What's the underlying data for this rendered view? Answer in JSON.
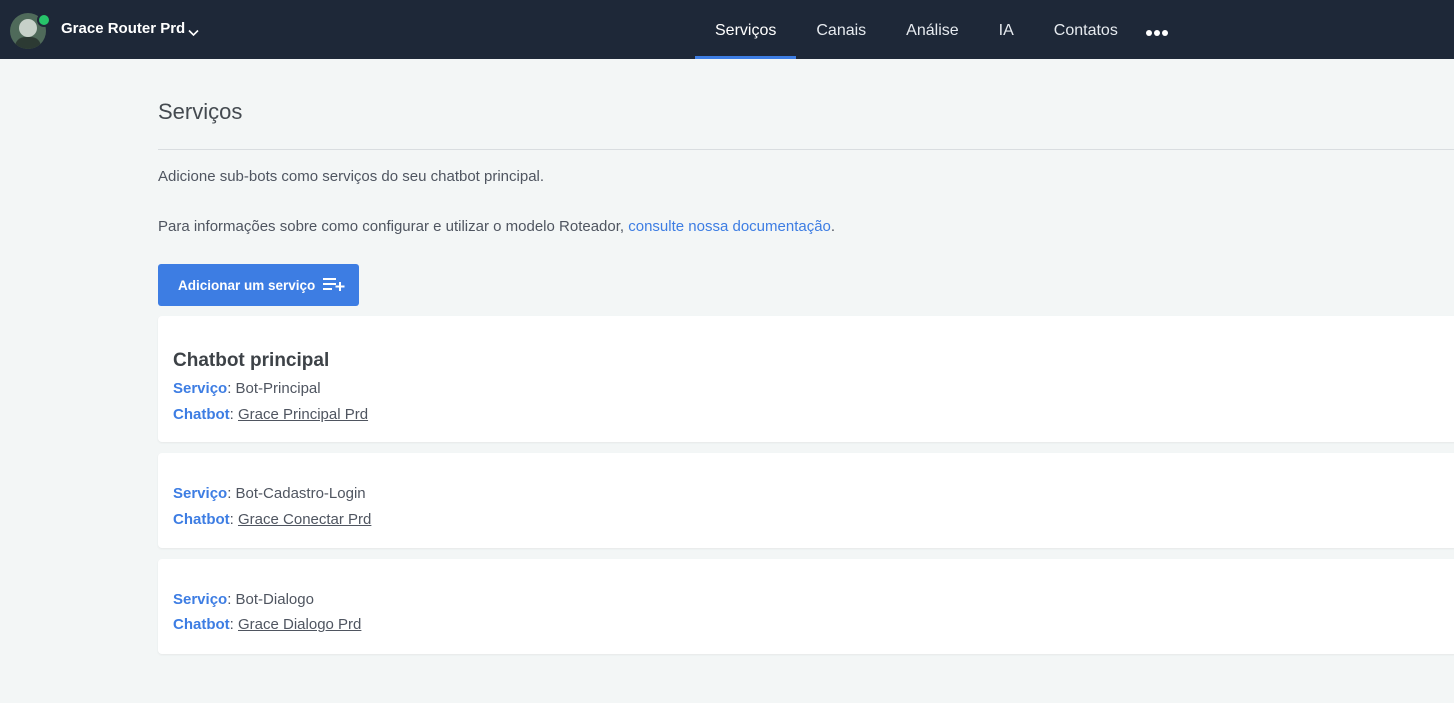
{
  "header": {
    "bot_name": "Grace Router Prd",
    "nav": [
      {
        "label": "Serviços",
        "active": true
      },
      {
        "label": "Canais"
      },
      {
        "label": "Análise"
      },
      {
        "label": "IA"
      },
      {
        "label": "Contatos"
      }
    ],
    "more_icon": "ellipsis-icon"
  },
  "page": {
    "title": "Serviços",
    "description": "Adicione sub-bots como serviços do seu chatbot principal.",
    "info_prefix": "Para informações sobre como configurar e utilizar o modelo Roteador, ",
    "info_link": "consulte nossa documentação",
    "info_suffix": ".",
    "add_button_label": "Adicionar um serviço"
  },
  "labels": {
    "service": "Serviço",
    "chatbot": "Chatbot",
    "sep": ": "
  },
  "cards": [
    {
      "title": "Chatbot principal",
      "service": "Bot-Principal",
      "chatbot": "Grace Principal Prd"
    },
    {
      "service": "Bot-Cadastro-Login",
      "chatbot": "Grace Conectar Prd"
    },
    {
      "service": "Bot-Dialogo",
      "chatbot": "Grace Dialogo Prd"
    }
  ],
  "colors": {
    "topbar": "#1e2838",
    "accent": "#3d7de3",
    "online": "#27c46a"
  }
}
